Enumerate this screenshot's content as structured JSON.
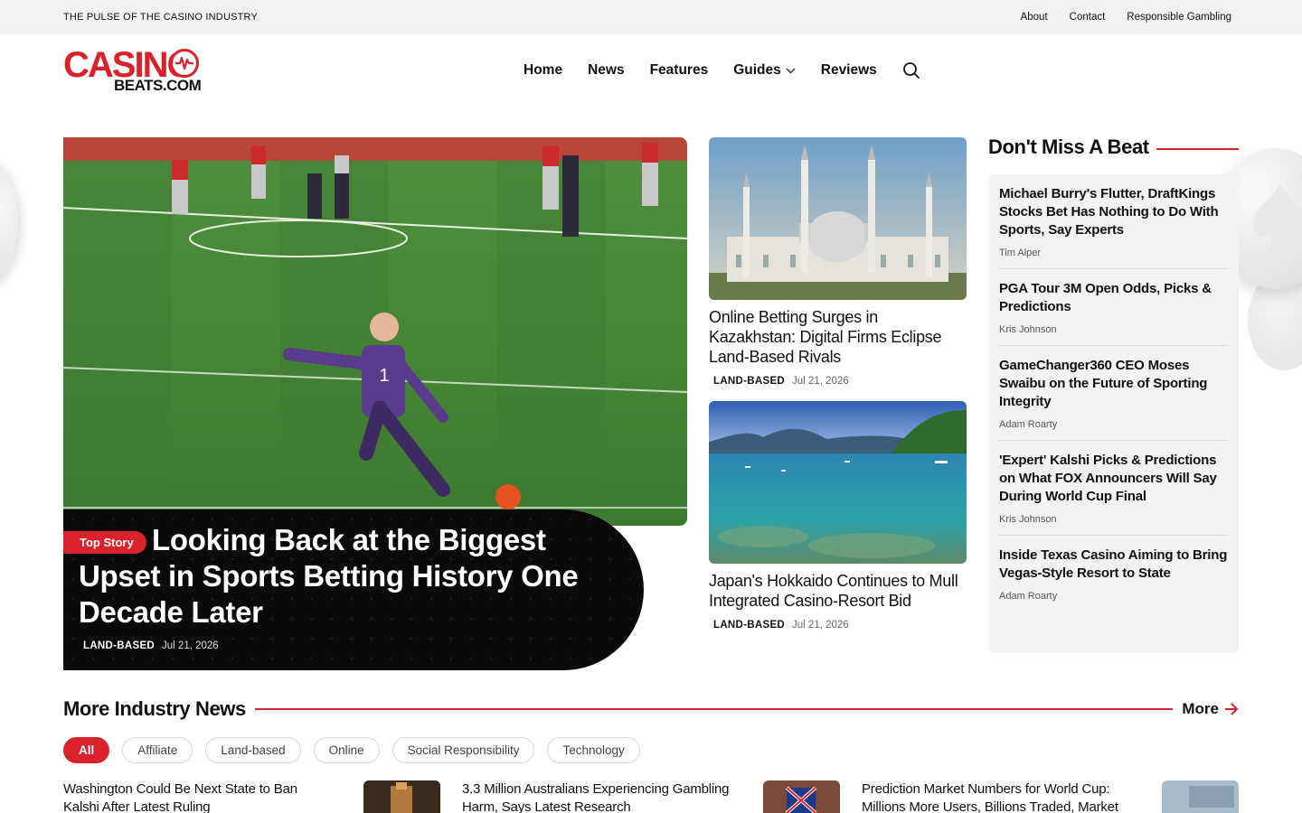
{
  "topbar": {
    "tagline": "THE PULSE OF THE CASINO INDUSTRY",
    "links": [
      "About",
      "Contact",
      "Responsible Gambling"
    ]
  },
  "logo": {
    "casino": "CASINO",
    "beats": "BEATS.COM"
  },
  "nav": {
    "items": [
      "Home",
      "News",
      "Features",
      "Guides",
      "Reviews"
    ]
  },
  "hero": {
    "tag": "Top Story",
    "title": "Looking Back at the Biggest Upset in Sports Betting History One Decade Later",
    "category": "LAND-BASED",
    "date": "Jul 21, 2026"
  },
  "cards": [
    {
      "title": "Online Betting Surges in Kazakhstan: Digital Firms Eclipse Land-Based Rivals",
      "category": "LAND-BASED",
      "date": "Jul 21, 2026"
    },
    {
      "title": "Japan's Hokkaido Continues to Mull Integrated Casino-Resort Bid",
      "category": "LAND-BASED",
      "date": "Jul 21, 2026"
    }
  ],
  "sidebar": {
    "heading": "Don't Miss A Beat",
    "items": [
      {
        "title": "Michael Burry's Flutter, DraftKings Stocks Bet Has Nothing to Do With Sports, Say Experts",
        "author": "Tim Alper"
      },
      {
        "title": "PGA Tour 3M Open Odds, Picks & Predictions",
        "author": "Kris Johnson"
      },
      {
        "title": "GameChanger360 CEO Moses Swaibu on the Future of Sporting Integrity",
        "author": "Adam Roarty"
      },
      {
        "title": "'Expert' Kalshi Picks & Predictions on What FOX Announcers Will Say During World Cup Final",
        "author": "Kris Johnson"
      },
      {
        "title": "Inside Texas Casino Aiming to Bring Vegas-Style Resort to State",
        "author": "Adam Roarty"
      }
    ]
  },
  "more_news": {
    "heading": "More Industry News",
    "more_label": "More",
    "filters": [
      "All",
      "Affiliate",
      "Land-based",
      "Online",
      "Social Responsibility",
      "Technology"
    ],
    "items": [
      "Washington Could Be Next State to Ban Kalshi After Latest Ruling",
      "3.3 Million Australians Experiencing Gambling Harm, Says Latest Research",
      "Prediction Market Numbers for World Cup: Millions More Users, Billions Traded, Market"
    ]
  },
  "colors": {
    "accent": "#d9222a",
    "text": "#111111",
    "panel": "#f3f3f3"
  }
}
